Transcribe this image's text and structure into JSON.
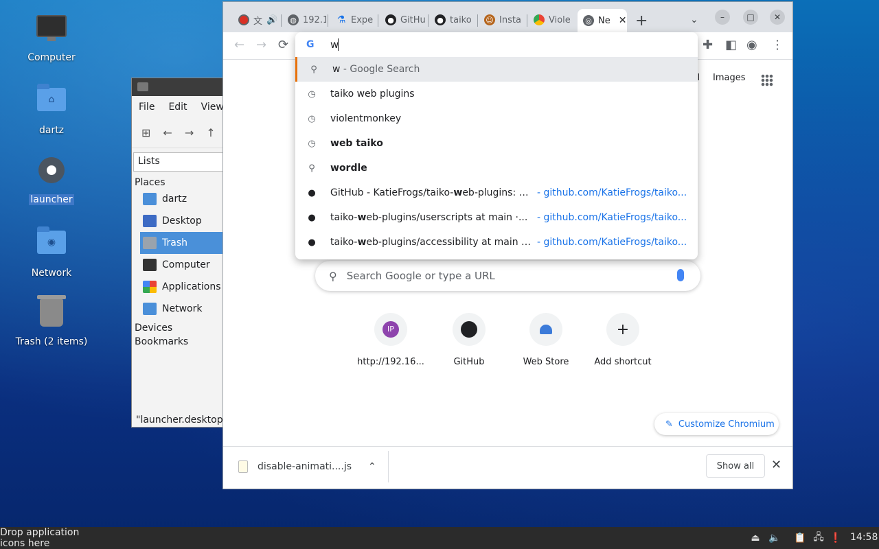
{
  "desktop": {
    "icons": [
      {
        "label": "Computer"
      },
      {
        "label": "dartz"
      },
      {
        "label": "launcher"
      },
      {
        "label": "Network"
      },
      {
        "label": "Trash (2 items)"
      }
    ]
  },
  "file_manager": {
    "menu": [
      "File",
      "Edit",
      "View"
    ],
    "lists_label": "Lists",
    "places_header": "Places",
    "places": [
      {
        "label": "dartz",
        "color": "#4a8fd9"
      },
      {
        "label": "Desktop",
        "color": "#3d6bc4"
      },
      {
        "label": "Trash",
        "color": "#8f8f8f"
      },
      {
        "label": "Computer",
        "color": "#333333"
      },
      {
        "label": "Applications",
        "color": "#e44"
      },
      {
        "label": "Network",
        "color": "#4a8fd9"
      }
    ],
    "devices_header": "Devices",
    "bookmarks_header": "Bookmarks",
    "status": "\"launcher.desktop."
  },
  "browser": {
    "tabs": [
      {
        "title": "",
        "icon": "recording-icon",
        "color": "#d93025"
      },
      {
        "title": "192.1",
        "icon": "globe-icon",
        "color": "#5f6368"
      },
      {
        "title": "Expe",
        "icon": "flask-icon",
        "color": "#1a73e8"
      },
      {
        "title": "GitHu",
        "icon": "github-icon",
        "color": "#202124"
      },
      {
        "title": "taiko",
        "icon": "github-icon",
        "color": "#202124"
      },
      {
        "title": "Insta",
        "icon": "monkey-icon",
        "color": "#b5651d"
      },
      {
        "title": "Viole",
        "icon": "webstore-icon",
        "color": "#e37400"
      },
      {
        "title": "Ne",
        "icon": "chromium-icon",
        "color": "#5f6368"
      }
    ],
    "omnibox": {
      "value": "w",
      "suggestions": [
        {
          "icon": "search-icon",
          "pre": "w",
          "bold": "",
          "post": "",
          "suffix": " - Google Search",
          "url": ""
        },
        {
          "icon": "history-icon",
          "pre": "taiko web plugins",
          "bold": "",
          "post": "",
          "suffix": "",
          "url": ""
        },
        {
          "icon": "history-icon",
          "pre": "violentmonkey",
          "bold": "",
          "post": "",
          "suffix": "",
          "url": ""
        },
        {
          "icon": "history-icon",
          "pre": "w",
          "bold": "eb taiko",
          "post": "",
          "suffix": "",
          "url": ""
        },
        {
          "icon": "search-icon",
          "pre": "w",
          "bold": "ordle",
          "post": "",
          "suffix": "",
          "url": ""
        },
        {
          "icon": "github-icon",
          "pre": "GitHub - KatieFrogs/taiko-",
          "bold": "w",
          "post": "eb-plugins: C...",
          "suffix": "",
          "url": "- github.com/KatieFrogs/taiko..."
        },
        {
          "icon": "github-icon",
          "pre": "taiko-",
          "bold": "w",
          "post": "eb-plugins/userscripts at main ·...",
          "suffix": "",
          "url": "- github.com/KatieFrogs/taiko..."
        },
        {
          "icon": "github-icon",
          "pre": "taiko-",
          "bold": "w",
          "post": "eb-plugins/accessibility at main ·...",
          "suffix": "",
          "url": "- github.com/KatieFrogs/taiko..."
        }
      ]
    },
    "ntp": {
      "gmail_partial": "il",
      "images": "Images",
      "search_placeholder": "Search Google or type a URL",
      "shortcuts": [
        {
          "label": "http://192.16...",
          "badge": "IP"
        },
        {
          "label": "GitHub",
          "badge": ""
        },
        {
          "label": "Web Store",
          "badge": ""
        },
        {
          "label": "Add shortcut",
          "badge": "+"
        }
      ],
      "customize": "Customize Chromium"
    },
    "download": {
      "filename": "disable-animati....js",
      "show_all": "Show all"
    }
  },
  "taskbar": {
    "drop_text": "Drop application icons here",
    "clock": "14:58"
  }
}
